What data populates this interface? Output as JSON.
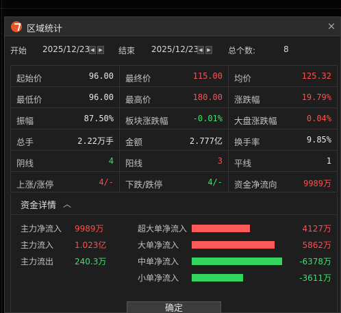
{
  "title": "区域统计",
  "close_glyph": "×",
  "dates": {
    "start_label": "开始",
    "start_value": "2025/12/23",
    "end_label": "结束",
    "end_value": "2025/12/23",
    "count_label": "总个数:",
    "count_value": "8",
    "arrow_left": "◀",
    "arrow_right": "▶"
  },
  "stats": [
    [
      {
        "k": "起始价",
        "v": "96.00",
        "c": "white"
      },
      {
        "k": "最终价",
        "v": "115.00",
        "c": "red"
      },
      {
        "k": "均价",
        "v": "125.32",
        "c": "red"
      }
    ],
    [
      {
        "k": "最低价",
        "v": "96.00",
        "c": "white"
      },
      {
        "k": "最高价",
        "v": "180.00",
        "c": "red"
      },
      {
        "k": "涨跌幅",
        "v": "19.79%",
        "c": "red"
      }
    ],
    [
      {
        "k": "振幅",
        "v": "87.50%",
        "c": "white"
      },
      {
        "k": "板块涨跌幅",
        "v": "-0.01%",
        "c": "green"
      },
      {
        "k": "大盘涨跌幅",
        "v": "0.04%",
        "c": "red"
      }
    ],
    [
      {
        "k": "总手",
        "v": "2.22万手",
        "c": "white"
      },
      {
        "k": "金额",
        "v": "2.777亿",
        "c": "white"
      },
      {
        "k": "换手率",
        "v": "9.85%",
        "c": "white"
      }
    ],
    [
      {
        "k": "阴线",
        "v": "4",
        "c": "green"
      },
      {
        "k": "阳线",
        "v": "3",
        "c": "red"
      },
      {
        "k": "平线",
        "v": "1",
        "c": "white"
      }
    ],
    [
      {
        "k": "上涨/涨停",
        "v": "4/-",
        "c": "red"
      },
      {
        "k": "下跌/跌停",
        "v": "4/-",
        "c": "green"
      },
      {
        "k": "资金净流向",
        "v": "9989万",
        "c": "red"
      }
    ]
  ],
  "funds": {
    "section_title": "资金详情",
    "chevron": "︿",
    "main": [
      {
        "k": "主力净流入",
        "v": "9989万",
        "c": "red"
      },
      {
        "k": "主力流入",
        "v": "1.023亿",
        "c": "red"
      },
      {
        "k": "主力流出",
        "v": "240.3万",
        "c": "green"
      }
    ],
    "orders": [
      {
        "k": "超大单净流入",
        "v": "4127万",
        "c": "red",
        "amount": 4127
      },
      {
        "k": "大单净流入",
        "v": "5862万",
        "c": "red",
        "amount": 5862
      },
      {
        "k": "中单净流入",
        "v": "-6378万",
        "c": "green",
        "amount": -6378
      },
      {
        "k": "小单净流入",
        "v": "-3611万",
        "c": "green",
        "amount": -3611
      }
    ]
  },
  "colors": {
    "red": "#ff4f4f",
    "green": "#3fe06a",
    "bar_red": "#ff5a5a",
    "bar_green": "#33d35f"
  },
  "ok_label": "确定"
}
